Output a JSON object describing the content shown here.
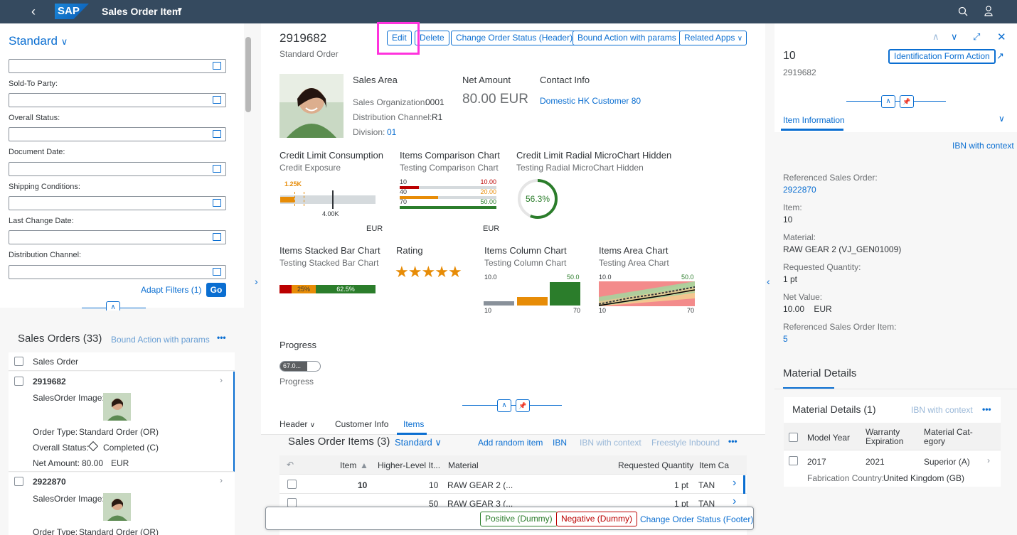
{
  "shell": {
    "title": "Sales Order Item"
  },
  "filter": {
    "variant": "Standard",
    "labels": [
      "Sold-To Party:",
      "Overall Status:",
      "Document Date:",
      "Shipping Conditions:",
      "Last Change Date:",
      "Distribution Channel:"
    ],
    "adapt": "Adapt Filters (1)",
    "go": "Go"
  },
  "list": {
    "title": "Sales Orders (33)",
    "bound_action": "Bound Action with params",
    "header": "Sales Order",
    "items": [
      {
        "id": "2919682",
        "image_label": "SalesOrder Image:",
        "order_type_label": "Order Type:",
        "order_type": "Standard Order (OR)",
        "status_label": "Overall Status:",
        "status": "Completed (C)",
        "net_label": "Net Amount:",
        "net": "80.00",
        "currency": "EUR"
      },
      {
        "id": "2922870",
        "image_label": "SalesOrder Image:",
        "order_type_label": "Order Type:",
        "order_type": "Standard Order (OR)"
      }
    ]
  },
  "object": {
    "title": "2919682",
    "subtitle": "Standard Order",
    "actions": [
      "Edit",
      "Delete",
      "Change Order Status (Header)",
      "Bound Action with params",
      "Related Apps"
    ],
    "sales_area": {
      "title": "Sales Area",
      "org_label": "Sales Organization:",
      "org": "0001",
      "channel_label": "Distribution Channel:",
      "channel": "R1",
      "division_label": "Division:",
      "division": "01"
    },
    "net_amount": {
      "title": "Net Amount",
      "value": "80.00 EUR"
    },
    "contact": {
      "title": "Contact Info",
      "value": "Domestic HK Customer 80"
    },
    "charts": {
      "bullet": {
        "title": "Credit Limit Consumption",
        "subtitle": "Credit Exposure",
        "value_label": "1.25K",
        "target_label": "4.00K",
        "unit": "EUR"
      },
      "comparison": {
        "title": "Items Comparison Chart",
        "subtitle": "Testing Comparison Chart",
        "rows": [
          {
            "l": "10",
            "r": "10.00",
            "color": "#bb0000",
            "frac": 0.2
          },
          {
            "l": "40",
            "r": "20.00",
            "color": "#e78c07",
            "frac": 0.4
          },
          {
            "l": "70",
            "r": "50.00",
            "color": "#2b7d2b",
            "frac": 1.0
          }
        ],
        "unit": "EUR"
      },
      "radial": {
        "title": "Credit Limit Radial MicroChart Hidden",
        "subtitle": "Testing Radial MicroChart Hidden",
        "value": "56.3%",
        "percent": 56.3
      },
      "stacked": {
        "title": "Items Stacked Bar Chart",
        "subtitle": "Testing Stacked Bar Chart",
        "seg2": "25%",
        "seg3": "62.5%"
      },
      "rating": {
        "title": "Rating",
        "value": 5
      },
      "column": {
        "title": "Items Column Chart",
        "subtitle": "Testing Column Chart",
        "tl": "10.0",
        "tr": "50.0",
        "bl": "10",
        "br": "70"
      },
      "area": {
        "title": "Items Area Chart",
        "subtitle": "Testing Area Chart",
        "tl": "10.0",
        "tr": "50.0",
        "bl": "10",
        "br": "70"
      }
    },
    "progress": {
      "title": "Progress",
      "value": "67.0...",
      "label": "Progress",
      "percent": 67
    },
    "tabs": [
      "Header",
      "Customer Info",
      "Items"
    ],
    "items_table": {
      "title": "Sales Order Items (3)",
      "variant": "Standard",
      "actions": [
        "Add random item",
        "IBN",
        "IBN with context",
        "Freestyle Inbound"
      ],
      "columns": [
        "Item",
        "Higher-Level It...",
        "Material",
        "Requested Quantity",
        "Item Ca"
      ],
      "rows": [
        {
          "item": "10",
          "higher": "10",
          "material": "RAW GEAR 2 (...",
          "qty": "1 pt",
          "cat": "TAN"
        },
        {
          "item": "",
          "higher": "50",
          "material": "RAW GEAR 3 (...",
          "qty": "1 pt",
          "cat": "TAN"
        }
      ]
    },
    "footer": {
      "positive": "Positive (Dummy)",
      "negative": "Negative (Dummy)",
      "change": "Change Order Status (Footer)"
    }
  },
  "detail": {
    "title": "10",
    "subtitle": "2919682",
    "action": "Identification Form Action",
    "tab": "Item Information",
    "ibn": "IBN with context",
    "fields": [
      {
        "label": "Referenced Sales Order:",
        "value": "2922870",
        "link": true
      },
      {
        "label": "Item:",
        "value": "10"
      },
      {
        "label": "Material:",
        "value": "RAW GEAR 2 (VJ_GEN01009)"
      },
      {
        "label": "Requested Quantity:",
        "value": "1 pt"
      },
      {
        "label": "Net Value:",
        "value": "10.00    EUR"
      },
      {
        "label": "Referenced Sales Order Item:",
        "value": "5",
        "link": true
      }
    ],
    "section": "Material Details",
    "table": {
      "title": "Material Details (1)",
      "ibn": "IBN with context",
      "columns": [
        "Model Year",
        "Warranty Expiration",
        "Material Cat-egory"
      ],
      "row": {
        "year": "2017",
        "warranty": "2021",
        "category": "Superior (A)"
      },
      "country_label": "Fabrication Country:",
      "country": "United Kingdom (GB)"
    }
  }
}
